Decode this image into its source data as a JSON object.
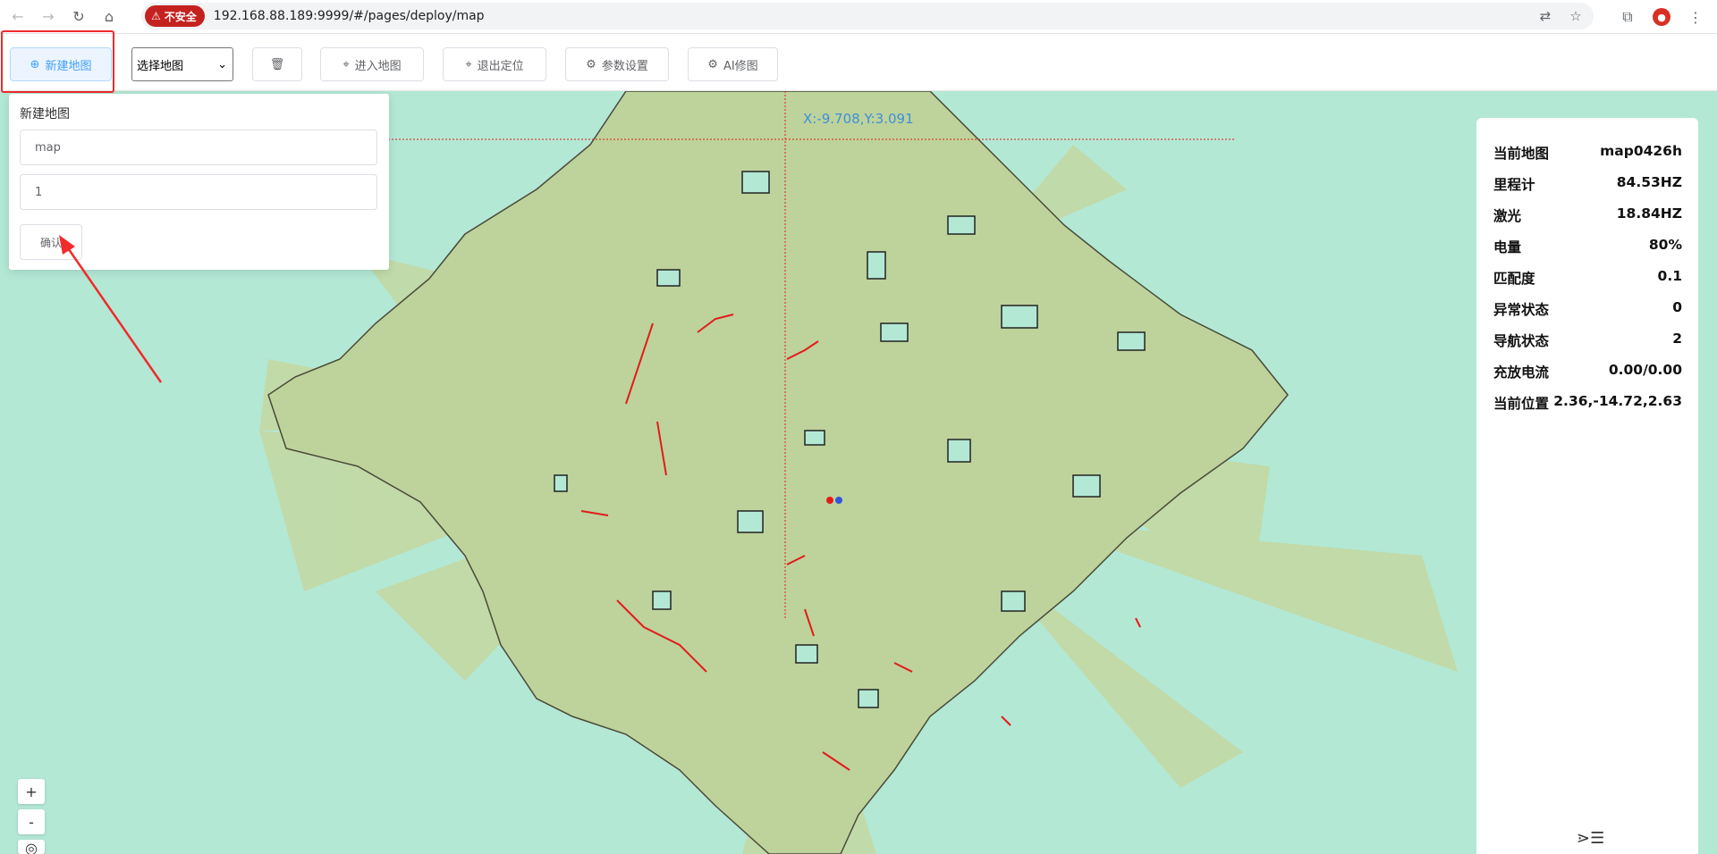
{
  "browser": {
    "security_label": "不安全",
    "url": "192.168.88.189:9999/#/pages/deploy/map"
  },
  "toolbar": {
    "new_map": "新建地图",
    "select_map": "选择地图",
    "enter_map": "进入地图",
    "exit_locate": "退出定位",
    "params": "参数设置",
    "ai_edit": "AI修图"
  },
  "popup": {
    "title": "新建地图",
    "name_value": "map",
    "second_value": "1",
    "confirm": "确认"
  },
  "map": {
    "cursor_coord": "X:-9.708,Y:3.091"
  },
  "info": {
    "rows": [
      {
        "label": "当前地图",
        "value": "map0426h"
      },
      {
        "label": "里程计",
        "value": "84.53HZ"
      },
      {
        "label": "激光",
        "value": "18.84HZ"
      },
      {
        "label": "电量",
        "value": "80%"
      },
      {
        "label": "匹配度",
        "value": "0.1"
      },
      {
        "label": "异常状态",
        "value": "0"
      },
      {
        "label": "导航状态",
        "value": "2"
      },
      {
        "label": "充放电流",
        "value": "0.00/0.00"
      },
      {
        "label": "当前位置",
        "value": "2.36,-14.72,2.63"
      }
    ]
  },
  "zoom": {
    "in": "+",
    "out": "-"
  }
}
